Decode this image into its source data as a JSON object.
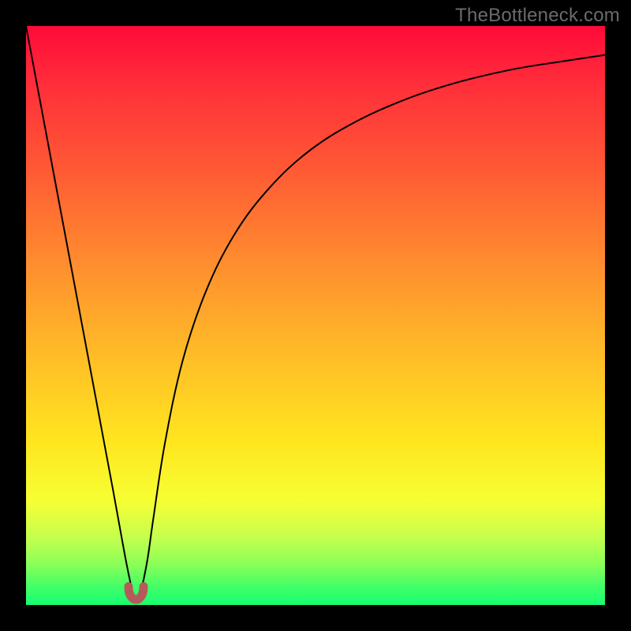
{
  "watermark": "TheBottleneck.com",
  "colors": {
    "curve_stroke": "#000000",
    "u_stroke": "#b55a5a",
    "gradient_top": "#ff0a3a",
    "gradient_bottom": "#16ff72",
    "frame": "#000000"
  },
  "chart_data": {
    "type": "line",
    "title": "",
    "xlabel": "",
    "ylabel": "",
    "xlim": [
      0,
      100
    ],
    "ylim": [
      0,
      100
    ],
    "series": [
      {
        "name": "bottleneck-curve",
        "x": [
          0,
          3,
          6,
          9,
          12,
          15,
          17,
          18,
          18.7,
          19.5,
          20,
          21,
          22,
          24,
          27,
          31,
          36,
          42,
          49,
          57,
          66,
          75,
          84,
          92,
          100
        ],
        "y": [
          100,
          84,
          68,
          52,
          36,
          20,
          9,
          4,
          1,
          1.5,
          3,
          8,
          15,
          28,
          42,
          54,
          64,
          72,
          78.5,
          83.5,
          87.5,
          90.4,
          92.5,
          93.8,
          95
        ]
      }
    ],
    "annotations": [
      {
        "name": "bottom-u-cap",
        "x": 19,
        "y": 1,
        "width_pct": 2.6,
        "shape": "U",
        "color": "#b55a5a"
      }
    ],
    "grid": false,
    "legend": false
  }
}
